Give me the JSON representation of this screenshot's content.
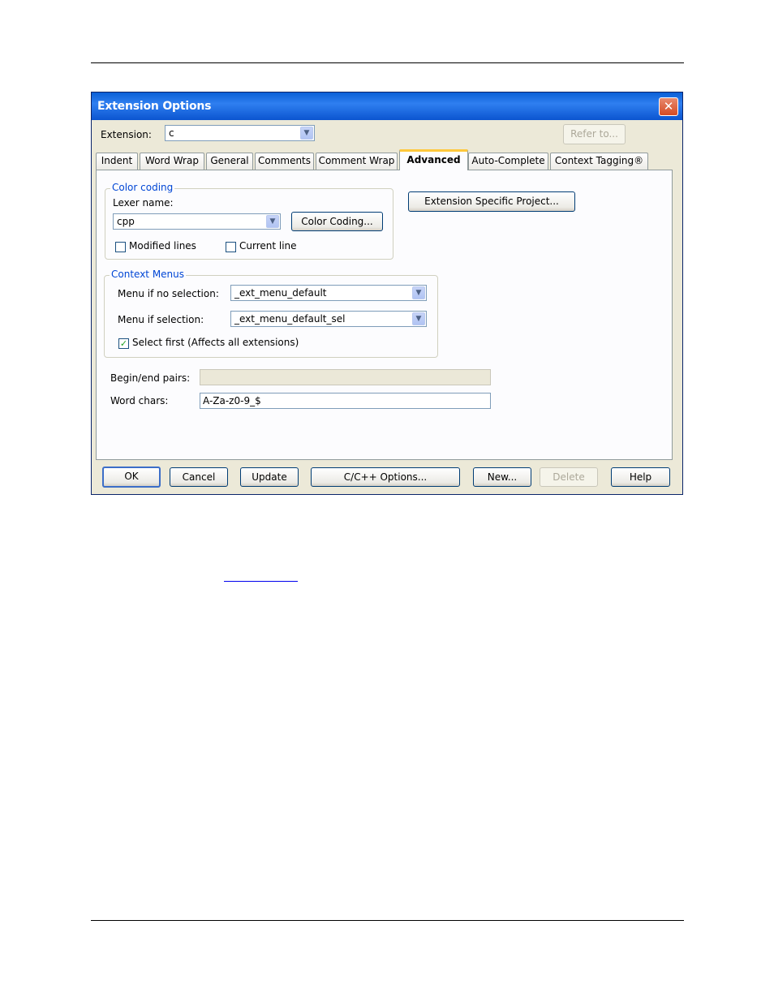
{
  "window": {
    "title": "Extension Options",
    "close_glyph": "✕"
  },
  "extension": {
    "label": "Extension:",
    "value": "c",
    "refer_label": "Refer to..."
  },
  "tabs": [
    {
      "label": "Indent"
    },
    {
      "label": "Word Wrap"
    },
    {
      "label": "General"
    },
    {
      "label": "Comments"
    },
    {
      "label": "Comment Wrap"
    },
    {
      "label": "Advanced",
      "active": true
    },
    {
      "label": "Auto-Complete"
    },
    {
      "label": "Context Tagging®"
    }
  ],
  "color_coding": {
    "title": "Color coding",
    "lexer_label": "Lexer name:",
    "lexer_value": "cpp",
    "button": "Color Coding...",
    "modified_lines": {
      "label": "Modified lines",
      "checked": false
    },
    "current_line": {
      "label": "Current line",
      "checked": false
    }
  },
  "project_button": "Extension Specific Project...",
  "context_menus": {
    "title": "Context Menus",
    "no_sel_label": "Menu if no selection:",
    "no_sel_value": "_ext_menu_default",
    "sel_label": "Menu if selection:",
    "sel_value": "_ext_menu_default_sel",
    "select_first": {
      "label": "Select first (Affects all extensions)",
      "checked": true,
      "glyph": "✓"
    }
  },
  "begin_end": {
    "label": "Begin/end pairs:",
    "value": ""
  },
  "word_chars": {
    "label": "Word chars:",
    "value": "A-Za-z0-9_$"
  },
  "footer": {
    "ok": "OK",
    "cancel": "Cancel",
    "update": "Update",
    "cpp_options": "C/C++ Options...",
    "new": "New...",
    "delete": "Delete",
    "help": "Help"
  },
  "icons": {
    "dropdown": "chevron-down-icon",
    "close": "close-icon",
    "check": "check-icon"
  }
}
